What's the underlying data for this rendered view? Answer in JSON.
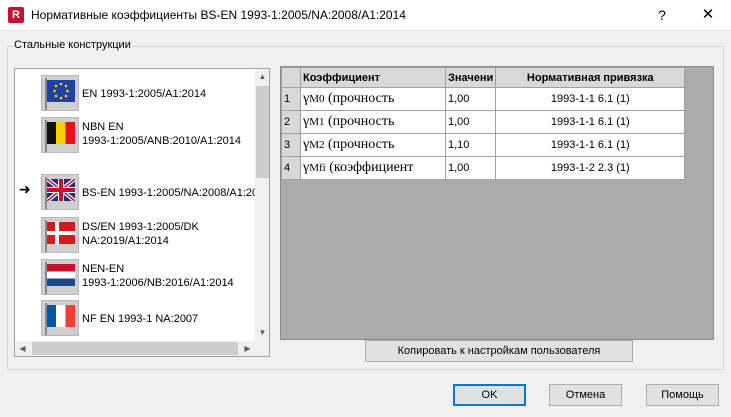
{
  "window": {
    "title": "Нормативные коэффициенты BS-EN 1993-1:2005/NA:2008/A1:2014",
    "app_icon_letter": "R",
    "help_label": "?",
    "close_label": "✕"
  },
  "group": {
    "label": "Стальные конструкции"
  },
  "annexes": [
    {
      "line1": "EN 1993-1:2005/A1:2014",
      "line2": "",
      "icon": "eu-flag-icon",
      "selected": false
    },
    {
      "line1": "NBN EN",
      "line2": "1993-1:2005/ANB:2010/A1:2014",
      "icon": "belgium-flag-icon",
      "selected": false
    },
    {
      "line1": "BS-EN 1993-1:2005/NA:2008/A1:20",
      "line2": "",
      "icon": "uk-flag-icon",
      "selected": true
    },
    {
      "line1": "DS/EN 1993-1:2005/DK",
      "line2": "NA:2019/A1:2014",
      "icon": "denmark-flag-icon",
      "selected": false
    },
    {
      "line1": "NEN-EN",
      "line2": "1993-1:2006/NB:2016/A1:2014",
      "icon": "netherlands-flag-icon",
      "selected": false
    },
    {
      "line1": "NF EN 1993-1 NA:2007",
      "line2": "",
      "icon": "france-flag-icon",
      "selected": false
    }
  ],
  "selection_marker": "➜",
  "table": {
    "headers": [
      "Коэффициент",
      "Значени",
      "Нормативная привязка"
    ],
    "rows": [
      {
        "num": "1",
        "symbol": "γ",
        "sub": "M0",
        "text": " (прочность",
        "value": "1,00",
        "ref": "1993-1-1  6.1 (1)"
      },
      {
        "num": "2",
        "symbol": "γ",
        "sub": "M1",
        "text": " (прочность",
        "value": "1,00",
        "ref": "1993-1-1  6.1 (1)"
      },
      {
        "num": "3",
        "symbol": "γ",
        "sub": "M2",
        "text": " (прочность",
        "value": "1,10",
        "ref": "1993-1-1  6.1 (1)"
      },
      {
        "num": "4",
        "symbol": "γ",
        "sub": "Mfi",
        "text": " (коэффициент",
        "value": "1,00",
        "ref": "1993-1-2  2.3 (1)"
      }
    ]
  },
  "buttons": {
    "copy": "Копировать к настройкам пользователя",
    "ok": "OK",
    "cancel": "Отмена",
    "help": "Помощь"
  },
  "scroll_arrows": {
    "up": "▲",
    "down": "▼",
    "left": "◀",
    "right": "▶"
  },
  "colors": {
    "accent": "#0078d7",
    "app_icon": "#c8102e"
  }
}
